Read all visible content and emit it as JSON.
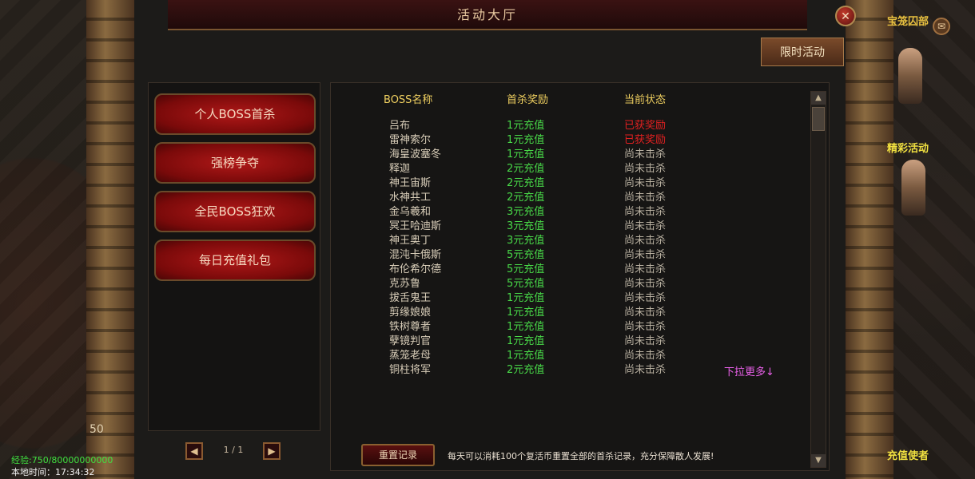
{
  "window": {
    "title": "活动大厅",
    "close_glyph": "✕",
    "tab_label": "限时活动"
  },
  "menu": [
    {
      "label": "个人BOSS首杀",
      "active": true
    },
    {
      "label": "强榜争夺",
      "active": false
    },
    {
      "label": "全民BOSS狂欢",
      "active": false
    },
    {
      "label": "每日充值礼包",
      "active": false
    }
  ],
  "pager": {
    "prev": "◀",
    "next": "▶",
    "text": "1 / 1"
  },
  "table": {
    "headers": {
      "name": "BOSS名称",
      "reward": "首杀奖励",
      "status": "当前状态"
    },
    "rows": [
      {
        "name": "吕布",
        "reward": "1元充值",
        "status": "已获奖励"
      },
      {
        "name": "雷神索尔",
        "reward": "1元充值",
        "status": "已获奖励"
      },
      {
        "name": "海皇波塞冬",
        "reward": "1元充值",
        "status": "尚未击杀"
      },
      {
        "name": "释迦",
        "reward": "2元充值",
        "status": "尚未击杀"
      },
      {
        "name": "神王宙斯",
        "reward": "2元充值",
        "status": "尚未击杀"
      },
      {
        "name": "水神共工",
        "reward": "2元充值",
        "status": "尚未击杀"
      },
      {
        "name": "金乌羲和",
        "reward": "3元充值",
        "status": "尚未击杀"
      },
      {
        "name": "冥王哈迪斯",
        "reward": "3元充值",
        "status": "尚未击杀"
      },
      {
        "name": "神王奥丁",
        "reward": "3元充值",
        "status": "尚未击杀"
      },
      {
        "name": "混沌卡俄斯",
        "reward": "5元充值",
        "status": "尚未击杀"
      },
      {
        "name": "布伦希尔德",
        "reward": "5元充值",
        "status": "尚未击杀"
      },
      {
        "name": "克苏鲁",
        "reward": "5元充值",
        "status": "尚未击杀"
      },
      {
        "name": "拔舌鬼王",
        "reward": "1元充值",
        "status": "尚未击杀"
      },
      {
        "name": "剪缘娘娘",
        "reward": "1元充值",
        "status": "尚未击杀"
      },
      {
        "name": "铁树尊者",
        "reward": "1元充值",
        "status": "尚未击杀"
      },
      {
        "name": "孽镜判官",
        "reward": "1元充值",
        "status": "尚未击杀"
      },
      {
        "name": "蒸笼老母",
        "reward": "1元充值",
        "status": "尚未击杀"
      },
      {
        "name": "铜柱将军",
        "reward": "2元充值",
        "status": "尚未击杀"
      }
    ],
    "more": "下拉更多↓"
  },
  "scroll": {
    "up": "▲",
    "down": "▼"
  },
  "footer": {
    "reset_label": "重置记录",
    "reset_desc": "每天可以消耗100个复活币重置全部的首杀记录，充分保障散人发展!"
  },
  "hud": {
    "exp": "经验:750/80000000000",
    "time": "本地时间：17:34:32",
    "level_fragment": "50",
    "npc_top": "宝笼囚部",
    "npc_activity": "精彩活动",
    "npc_recharge": "充值使者",
    "mail_icon": "✉"
  },
  "colors": {
    "reward_green": "#48d848",
    "status_red": "#e02020",
    "header_gold": "#f0d060",
    "more_pink": "#e860e8"
  }
}
